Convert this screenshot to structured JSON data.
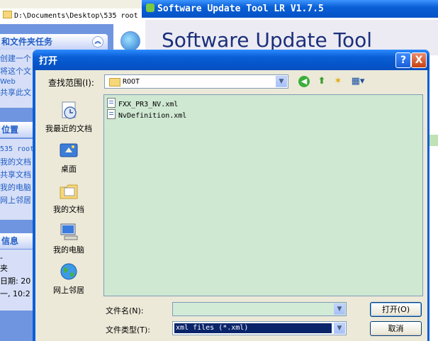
{
  "explorer": {
    "address": "D:\\Documents\\Desktop\\535 root",
    "tasks_panel": {
      "title": "和文件夹任务",
      "items": [
        "创建一个",
        "将这个文",
        "Web",
        "共享此文"
      ]
    },
    "places_panel": {
      "title": "位置",
      "items": [
        "535 root",
        "我的文档",
        "共享文档",
        "我的电脑",
        "网上邻居"
      ]
    },
    "details_panel": {
      "title": "信息",
      "items": [
        "-",
        "夹",
        "日期: 20",
        "一, 10:2"
      ]
    }
  },
  "app": {
    "title": "Software Update Tool LR V1.7.5",
    "heading": "Software Update Tool"
  },
  "dialog": {
    "title": "打开",
    "help_label": "?",
    "close_label": "X",
    "lookin_label": "查找范围(I):",
    "lookin_value": "ROOT",
    "places": [
      "我最近的文档",
      "桌面",
      "我的文档",
      "我的电脑",
      "网上邻居"
    ],
    "files": [
      "FXX_PR3_NV.xml",
      "NvDefinition.xml"
    ],
    "filename_label": "文件名(N):",
    "filename_value": "",
    "filetype_label": "文件类型(T):",
    "filetype_value": "xml files (*.xml)",
    "open_button": "打开(O)",
    "cancel_button": "取消"
  },
  "colors": {
    "title_bar": "#0a5fd6",
    "file_list_bg": "#cfe8d2",
    "dialog_bg": "#ece9d8",
    "selection": "#0a246a"
  }
}
